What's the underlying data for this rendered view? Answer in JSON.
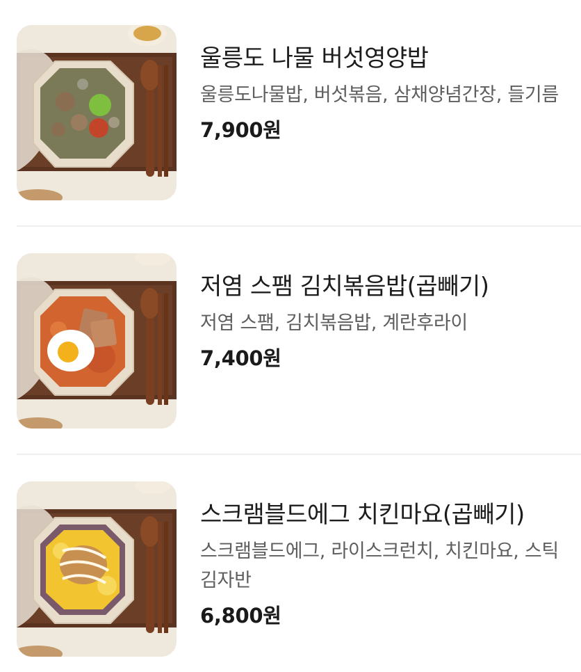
{
  "menu": {
    "items": [
      {
        "name": "울릉도 나물 버섯영양밥",
        "description": "울릉도나물밥, 버섯볶음, 삼채양념간장, 들기름",
        "price": "7,900원",
        "image": "mushroom-namul-rice-bowl"
      },
      {
        "name": "저염 스팸 김치볶음밥(곱빼기)",
        "description": "저염 스팸, 김치볶음밥, 계란후라이",
        "price": "7,400원",
        "image": "spam-kimchi-fried-rice-bowl"
      },
      {
        "name": "스크램블드에그 치킨마요(곱빼기)",
        "description": "스크램블드에그, 라이스크런치, 치킨마요, 스틱김자반",
        "price": "6,800원",
        "image": "scrambled-egg-chicken-mayo-bowl"
      }
    ]
  },
  "colors": {
    "background": "#ffffff",
    "name_text": "#1c1c1c",
    "description_text": "#5e5e5e",
    "price_text": "#1a1a1a",
    "divider": "#f0f0f0"
  }
}
